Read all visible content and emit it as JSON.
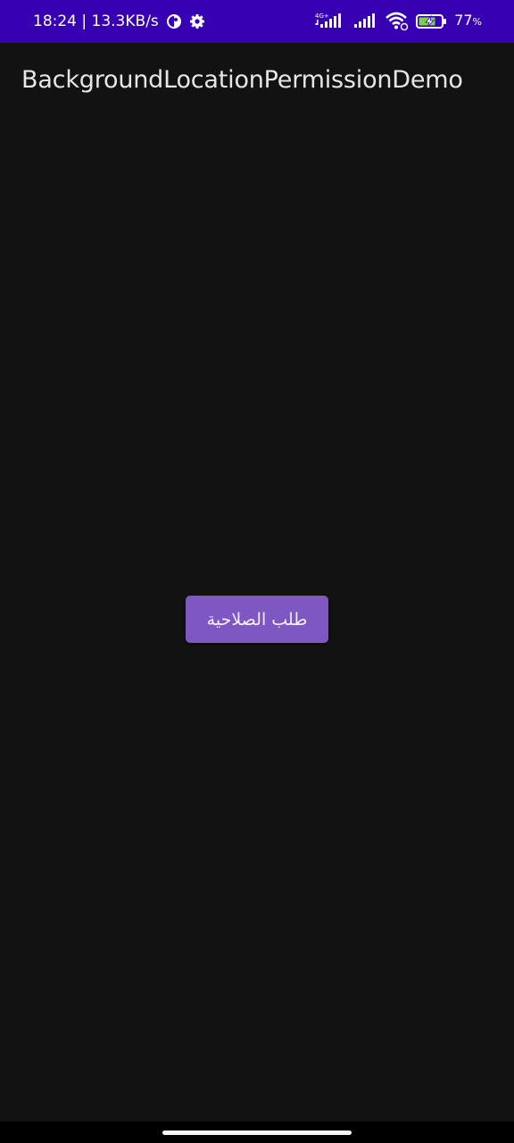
{
  "status_bar": {
    "time_speed": "18:24 | 13.3KB/s",
    "network_type": "4G+",
    "battery_percent": "77",
    "battery_unit": "%",
    "background_color": "#3700b3"
  },
  "app_bar": {
    "title": "BackgroundLocationPermissionDemo"
  },
  "main": {
    "request_permission_button_label": "طلب الصلاحية",
    "button_color": "#7e57c2",
    "background_color": "#121212"
  },
  "icons": {
    "data_saver": "data-saver-icon",
    "settings": "gear-icon",
    "signal_1": "signal-4g-icon",
    "signal_2": "signal-icon",
    "wifi": "wifi-icon",
    "battery": "battery-charging-icon"
  }
}
